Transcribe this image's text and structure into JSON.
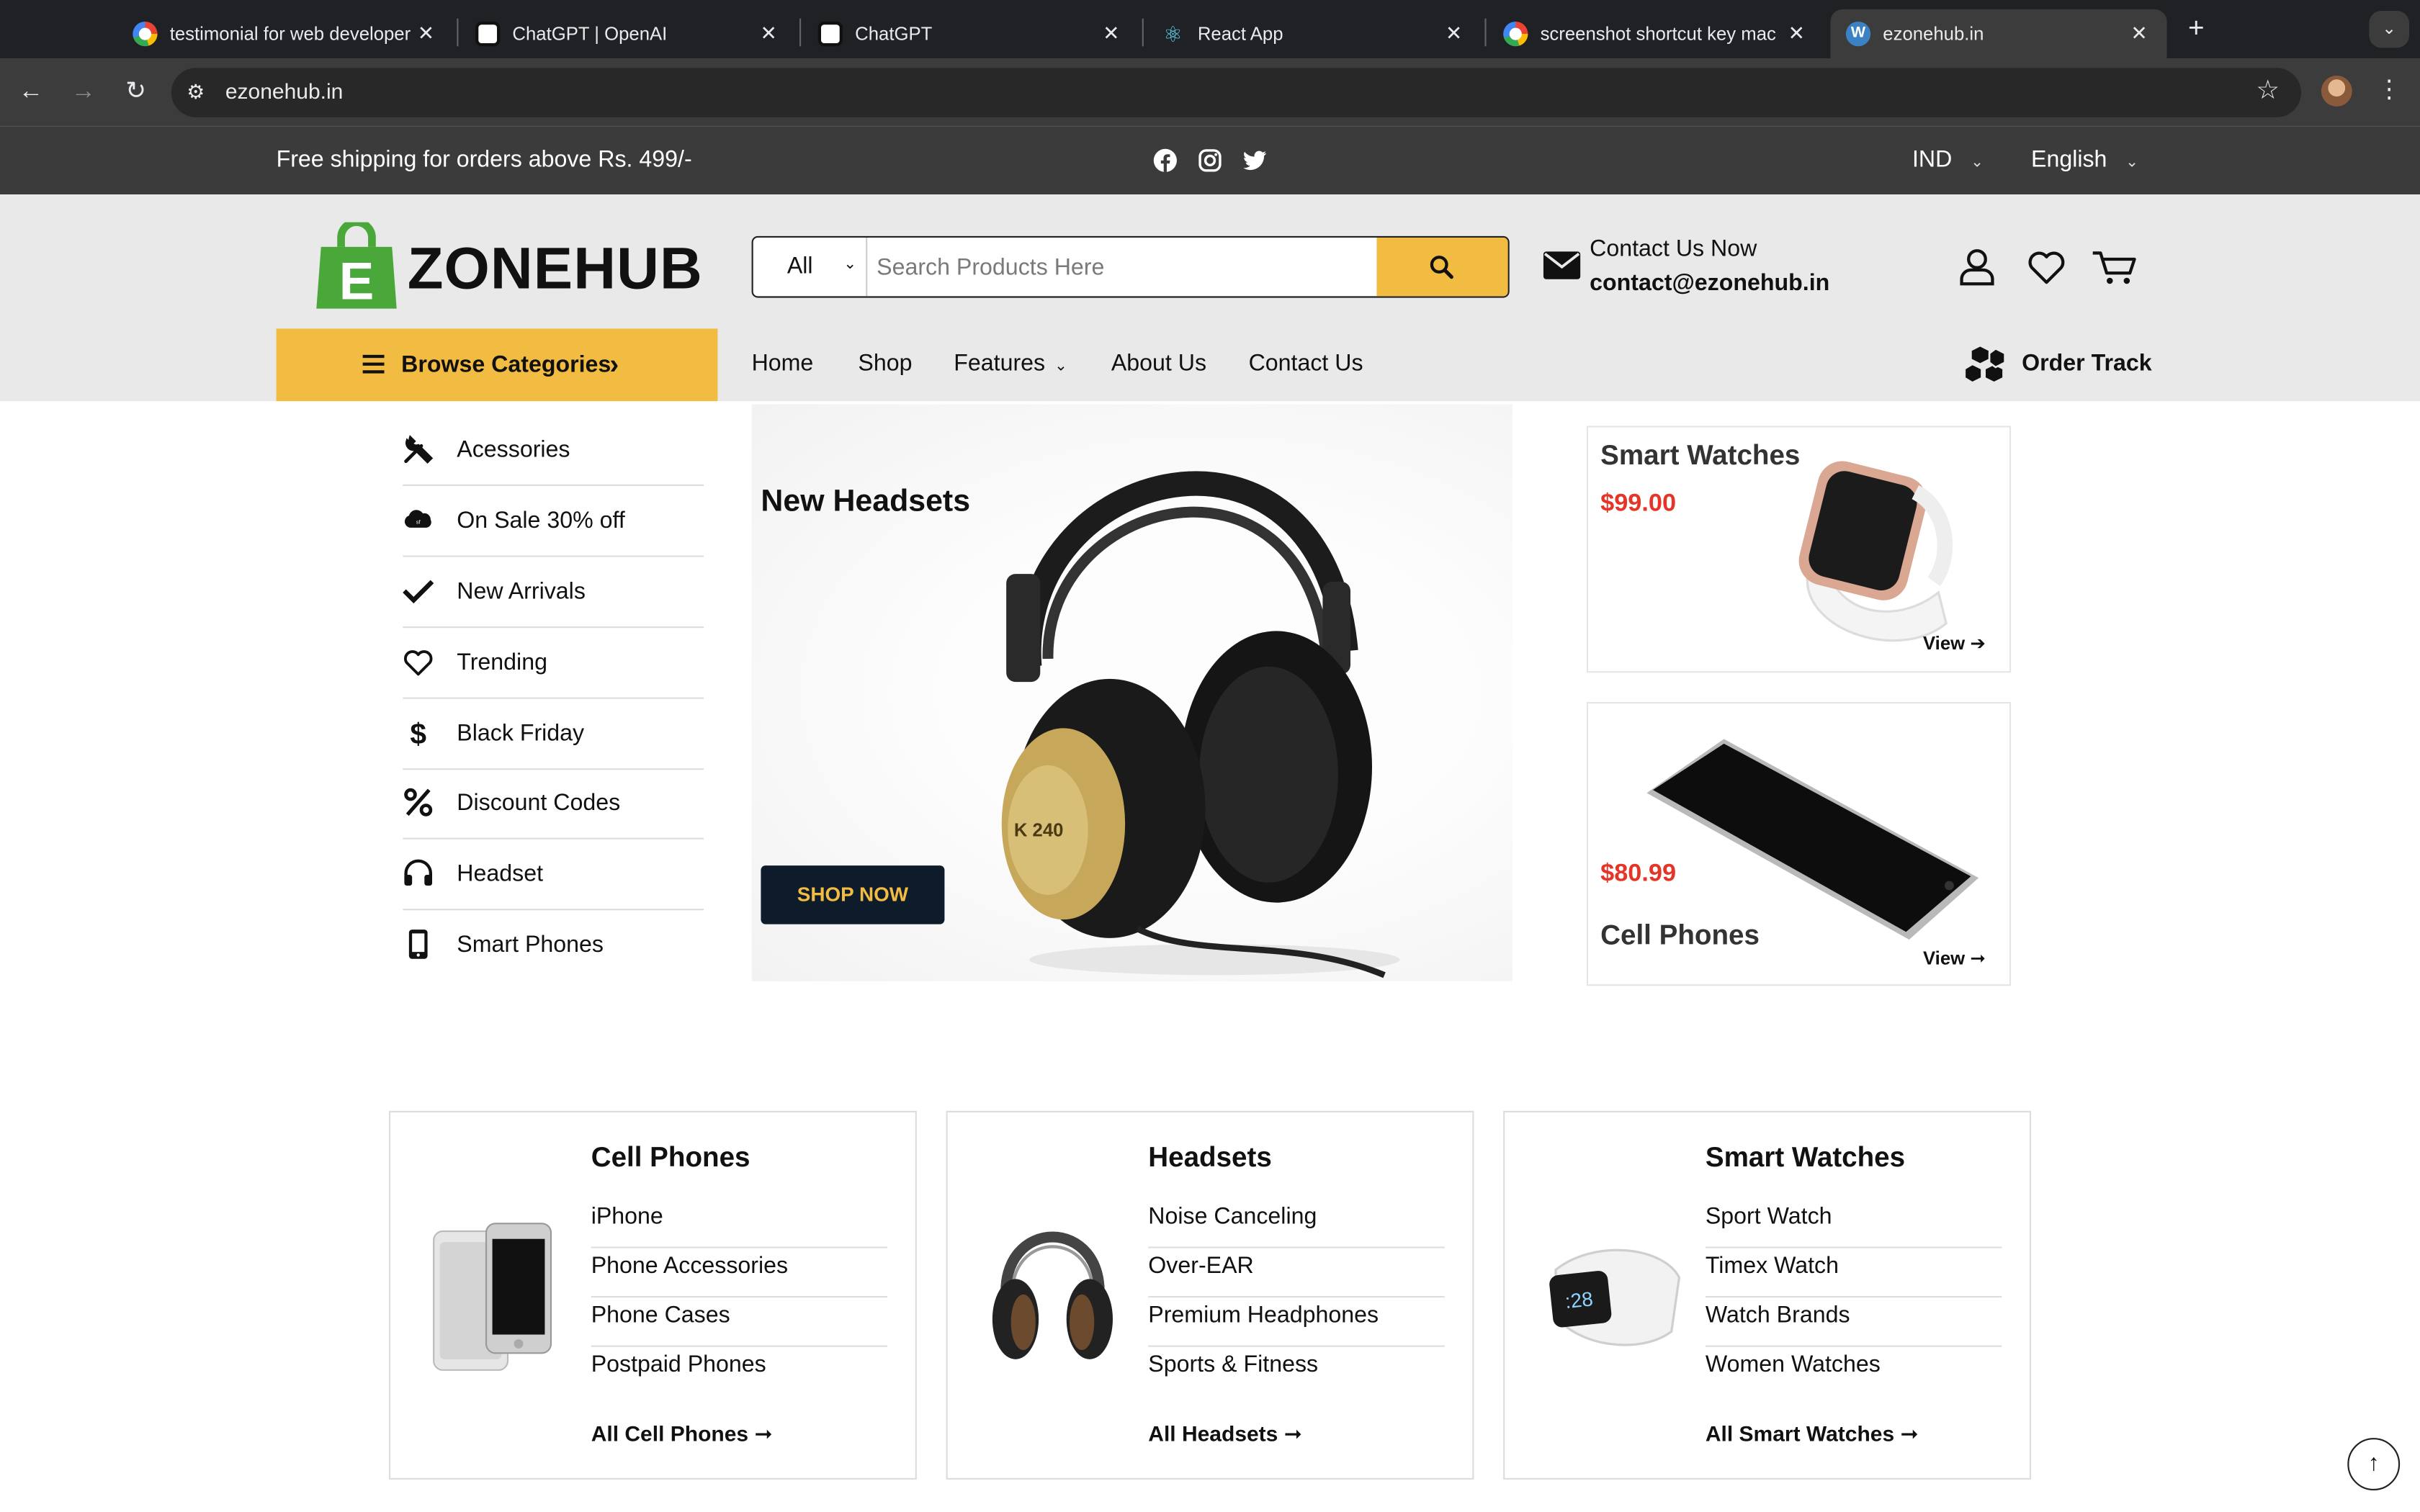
{
  "browser": {
    "tabs": [
      {
        "title": "testimonial for web developer",
        "favicon": "google-icon",
        "active": false
      },
      {
        "title": "ChatGPT | OpenAI",
        "favicon": "openai-icon",
        "active": false
      },
      {
        "title": "ChatGPT",
        "favicon": "chatgpt-icon",
        "active": false
      },
      {
        "title": "React App",
        "favicon": "react-icon",
        "active": false
      },
      {
        "title": "screenshot shortcut key mac",
        "favicon": "google-icon",
        "active": false
      },
      {
        "title": "ezonehub.in",
        "favicon": "wordpress-icon",
        "active": true
      }
    ],
    "close_glyph": "✕",
    "new_tab_glyph": "+",
    "url": "ezonehub.in"
  },
  "topbar": {
    "shipping": "Free shipping for orders above Rs. 499/-",
    "social": [
      "facebook-icon",
      "instagram-icon",
      "twitter-icon"
    ],
    "currency": "IND",
    "language": "English"
  },
  "header": {
    "logo_text": "ZONEHUB",
    "logo_letter": "E",
    "search": {
      "category": "All",
      "placeholder": "Search Products Here"
    },
    "contact_label": "Contact Us Now",
    "contact_email": "contact@ezonehub.in"
  },
  "nav": {
    "browse_label": "Browse Categories",
    "items": [
      "Home",
      "Shop",
      "Features",
      "About Us",
      "Contact Us"
    ],
    "order_track": "Order Track"
  },
  "categories": [
    {
      "label": "Acessories",
      "icon": "tools-icon"
    },
    {
      "label": "On Sale 30% off",
      "icon": "salesforce-icon"
    },
    {
      "label": "New Arrivals",
      "icon": "check-icon"
    },
    {
      "label": "Trending",
      "icon": "heart-icon"
    },
    {
      "label": "Black Friday",
      "icon": "dollar-icon"
    },
    {
      "label": "Discount Codes",
      "icon": "percent-icon"
    },
    {
      "label": "Headset",
      "icon": "headphones-icon"
    },
    {
      "label": "Smart Phones",
      "icon": "mobile-icon"
    }
  ],
  "hero": {
    "title": "New Headsets",
    "button": "SHOP NOW",
    "model_text": "K 240"
  },
  "promos": [
    {
      "title": "Smart Watches",
      "price": "$99.00",
      "view": "View"
    },
    {
      "title": "Cell Phones",
      "price": "$80.99",
      "view": "View"
    }
  ],
  "category_boxes": [
    {
      "title": "Cell Phones",
      "items": [
        "iPhone",
        "Phone Accessories",
        "Phone Cases",
        "Postpaid Phones"
      ],
      "all_link": "All Cell Phones"
    },
    {
      "title": "Headsets",
      "items": [
        "Noise Canceling",
        "Over-EAR",
        "Premium Headphones",
        "Sports & Fitness"
      ],
      "all_link": "All Headsets"
    },
    {
      "title": "Smart Watches",
      "items": [
        "Sport Watch",
        "Timex Watch",
        "Watch Brands",
        "Women Watches"
      ],
      "all_link": "All Smart Watches"
    }
  ],
  "colors": {
    "accent": "#f2bb42",
    "dark": "#0e1b2b",
    "price": "#e53528",
    "logo_green": "#4aa83a"
  }
}
